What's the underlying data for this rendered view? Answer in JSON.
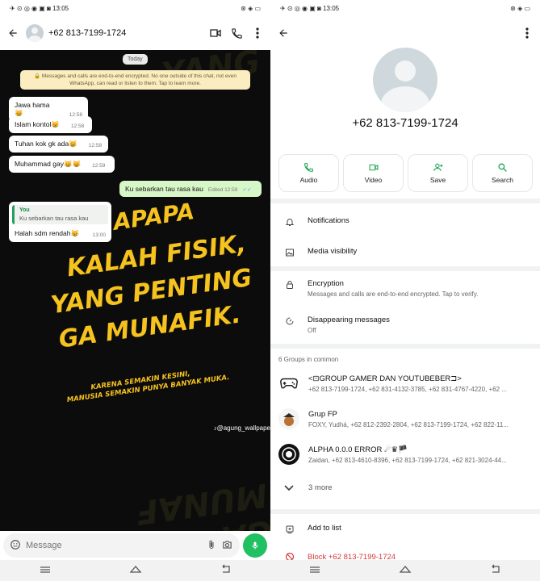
{
  "left": {
    "status": {
      "time": "13:05",
      "left_icons": "✈ ⊙ ◎ ◉ ▣ ◙",
      "right_icons": "⊛ ◈ ▭"
    },
    "header": {
      "contact": "+62 813-7199-1724"
    },
    "day_chip": "Today",
    "e2e_notice": "🔒 Messages and calls are end-to-end encrypted. No one outside of this chat, not even WhatsApp, can read or listen to them. Tap to learn more.",
    "messages": [
      {
        "text": "Jawa hama😸",
        "time": "12:58"
      },
      {
        "text": "Islam kontol😸",
        "time": "12:58"
      },
      {
        "text": "Tuhan kok gk ada😸",
        "time": "12:58"
      },
      {
        "text": "Muhammad gay😸😸",
        "time": "12:59"
      }
    ],
    "outgoing": {
      "text": "Ku sebarkan tau rasa kau",
      "time": "Edited 12:59",
      "ticks": "✓✓"
    },
    "reply": {
      "quote_author": "You",
      "quote_text": "Ku sebarkan tau rasa kau",
      "text": "Halah sdm rendah😸",
      "time": "13:00"
    },
    "wallpaper": {
      "line1": "APAPA",
      "line2": "KALAH FISIK,",
      "line3": "YANG PENTING",
      "line4": "GA MUNAFIK.",
      "small1": "KARENA SEMAKIN KESINI,",
      "small2": "MANUSIA SEMAKIN PUNYA BANYAK MUKA.",
      "bg_text_top": "YANG",
      "bg_text_bottom": "GA MUNAF",
      "watermark": "♪@agung_wallpape"
    },
    "input": {
      "placeholder": "Message"
    }
  },
  "right": {
    "status": {
      "time": "13:05",
      "left_icons": "✈ ⊙ ◎ ◉ ▣ ◙",
      "right_icons": "⊛ ◈ ▭"
    },
    "phone": "+62 813-7199-1724",
    "actions": [
      {
        "label": "Audio",
        "icon": "phone-icon"
      },
      {
        "label": "Video",
        "icon": "video-icon"
      },
      {
        "label": "Save",
        "icon": "add-person-icon"
      },
      {
        "label": "Search",
        "icon": "search-icon"
      }
    ],
    "notifications": "Notifications",
    "media_visibility": "Media visibility",
    "encryption": {
      "label": "Encryption",
      "sub": "Messages and calls are end-to-end encrypted. Tap to verify."
    },
    "disappearing": {
      "label": "Disappearing messages",
      "sub": "Off"
    },
    "groups_header": "6 Groups in common",
    "groups": [
      {
        "name": "<⊡GROUP GAMER DAN YOUTUBEBER⊐>",
        "members": "+62 813-7199-1724, +62 831-4132-3785, +62 831-4767-4220, +62 ..."
      },
      {
        "name": "Grup FP",
        "members": "FOXY, Yudhá, +62 812-2392-2804, +62 813-7199-1724, +62 822-11..."
      },
      {
        "name": "ALPHA 0.0.0 ERROR ☄♛🏴",
        "members": "Zaidan, +62 813-4610-8396, +62 813-7199-1724, +62 821-3024-44..."
      }
    ],
    "more": "3 more",
    "add_to_list": "Add to list",
    "block": "Block +62 813-7199-1724"
  },
  "colors": {
    "accent": "#1da851",
    "wallpaper_text": "#f6c21e",
    "outgoing_bubble": "#d8f7c8",
    "danger": "#d23a3a"
  }
}
